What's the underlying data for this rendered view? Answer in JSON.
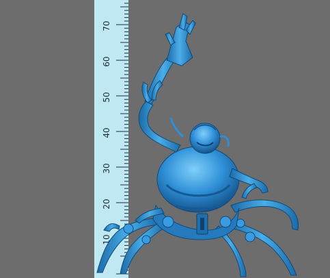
{
  "ruler": {
    "labels": [
      "10",
      "20",
      "30",
      "40",
      "50",
      "60",
      "70"
    ],
    "ruler_color": "#bfe8f2",
    "tick_color": "#1c2d3d"
  },
  "model": {
    "name": "spider-mech-figure",
    "color": "#2f8fd6",
    "highlight": "#6cc3f5",
    "shadow": "#155a93"
  },
  "background_color": "#6d6d6d"
}
